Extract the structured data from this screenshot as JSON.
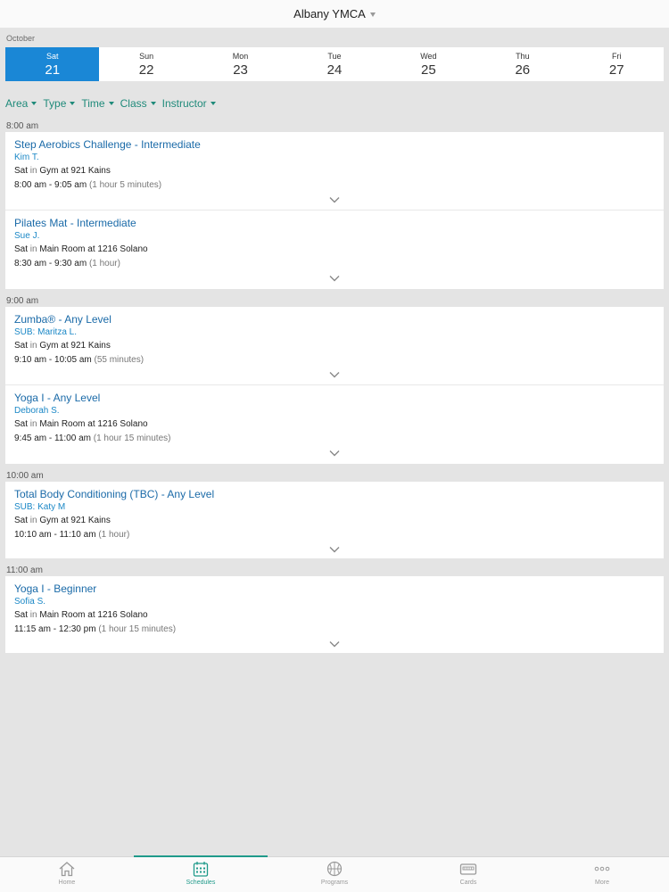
{
  "header": {
    "title": "Albany YMCA"
  },
  "month": "October",
  "days": [
    {
      "name": "Sat",
      "date": "21"
    },
    {
      "name": "Sun",
      "date": "22"
    },
    {
      "name": "Mon",
      "date": "23"
    },
    {
      "name": "Tue",
      "date": "24"
    },
    {
      "name": "Wed",
      "date": "25"
    },
    {
      "name": "Thu",
      "date": "26"
    },
    {
      "name": "Fri",
      "date": "27"
    }
  ],
  "filters": [
    "Area",
    "Type",
    "Time",
    "Class",
    "Instructor"
  ],
  "groups": [
    {
      "time": "8:00 am",
      "classes": [
        {
          "title": "Step Aerobics Challenge - Intermediate",
          "instructor": "Kim T.",
          "day": "Sat",
          "in": "in",
          "location": "Gym at 921 Kains",
          "time": "8:00 am - 9:05 am",
          "duration": "(1 hour 5 minutes)"
        },
        {
          "title": "Pilates Mat - Intermediate",
          "instructor": "Sue J.",
          "day": "Sat",
          "in": "in",
          "location": "Main Room at 1216 Solano",
          "time": "8:30 am - 9:30 am",
          "duration": "(1 hour)"
        }
      ]
    },
    {
      "time": "9:00 am",
      "classes": [
        {
          "title": "Zumba® - Any Level",
          "instructor": "SUB: Maritza L.",
          "day": "Sat",
          "in": "in",
          "location": "Gym at 921 Kains",
          "time": "9:10 am - 10:05 am",
          "duration": "(55 minutes)"
        },
        {
          "title": "Yoga I - Any Level",
          "instructor": "Deborah S.",
          "day": "Sat",
          "in": "in",
          "location": "Main Room at 1216 Solano",
          "time": "9:45 am - 11:00 am",
          "duration": "(1 hour 15 minutes)"
        }
      ]
    },
    {
      "time": "10:00 am",
      "classes": [
        {
          "title": "Total Body Conditioning (TBC) - Any Level",
          "instructor": "SUB: Katy M",
          "day": "Sat",
          "in": "in",
          "location": "Gym at 921 Kains",
          "time": "10:10 am - 11:10 am",
          "duration": "(1 hour)"
        }
      ]
    },
    {
      "time": "11:00 am",
      "classes": [
        {
          "title": "Yoga I - Beginner",
          "instructor": "Sofia S.",
          "day": "Sat",
          "in": "in",
          "location": "Main Room at 1216 Solano",
          "time": "11:15 am - 12:30 pm",
          "duration": "(1 hour 15 minutes)"
        }
      ]
    }
  ],
  "tabs": [
    {
      "label": "Home",
      "icon": "home-icon"
    },
    {
      "label": "Schedules",
      "icon": "calendar-icon"
    },
    {
      "label": "Programs",
      "icon": "basketball-icon"
    },
    {
      "label": "Cards",
      "icon": "card-icon"
    },
    {
      "label": "More",
      "icon": "more-icon"
    }
  ],
  "colors": {
    "accent": "#1a87d6",
    "teal": "#1f9a8a",
    "link": "#1a6aa8",
    "background": "#e4e4e4"
  }
}
